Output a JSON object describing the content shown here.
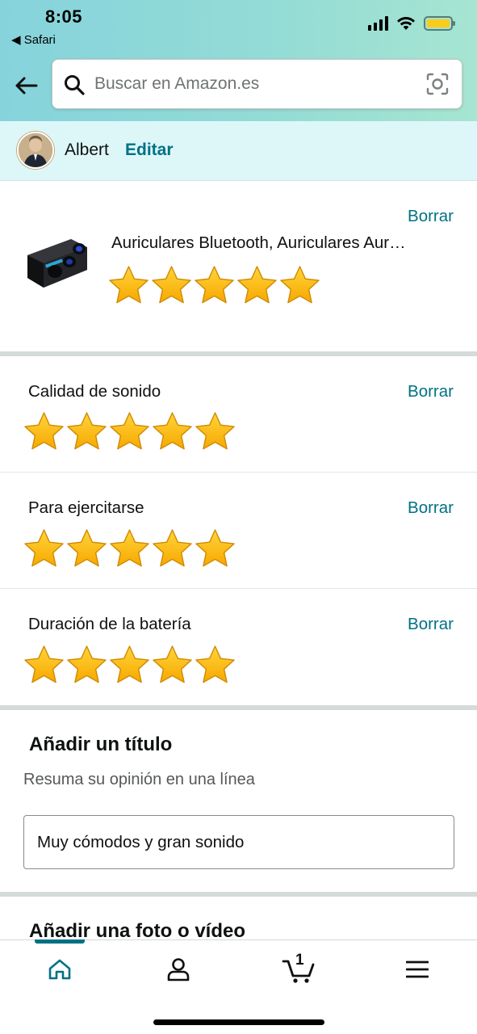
{
  "status_bar": {
    "time": "8:05",
    "back_app": "◀ Safari",
    "battery_color": "#f8cc1b",
    "icons": [
      "cellular-signal-icon",
      "wifi-icon",
      "battery-icon"
    ]
  },
  "header": {
    "back_icon": "arrow-left-icon",
    "search_placeholder": "Buscar en Amazon.es",
    "search_icon": "search-icon",
    "camera_icon": "camera-scan-icon"
  },
  "profile": {
    "name": "Albert",
    "edit_label": "Editar"
  },
  "product": {
    "title": "Auriculares Bluetooth, Auriculares Aur…",
    "rating": 5,
    "max_rating": 5,
    "remove_label": "Borrar"
  },
  "attributes": [
    {
      "label": "Calidad de sonido",
      "rating": 5,
      "remove_label": "Borrar"
    },
    {
      "label": "Para ejercitarse",
      "rating": 5,
      "remove_label": "Borrar"
    },
    {
      "label": "Duración de la batería",
      "rating": 5,
      "remove_label": "Borrar"
    }
  ],
  "title_section": {
    "heading": "Añadir un título",
    "helper": "Resuma su opinión en una línea",
    "value": "Muy cómodos y gran sonido"
  },
  "photo_section": {
    "heading": "Añadir una foto o vídeo"
  },
  "bottom_nav": {
    "items": [
      "home-icon",
      "account-icon",
      "cart-icon",
      "menu-icon"
    ],
    "active": "home-icon",
    "cart_count": "1"
  },
  "colors": {
    "accent_link": "#007185",
    "star_fill": "#ffb800",
    "profile_bar": "#ddf7f9"
  }
}
